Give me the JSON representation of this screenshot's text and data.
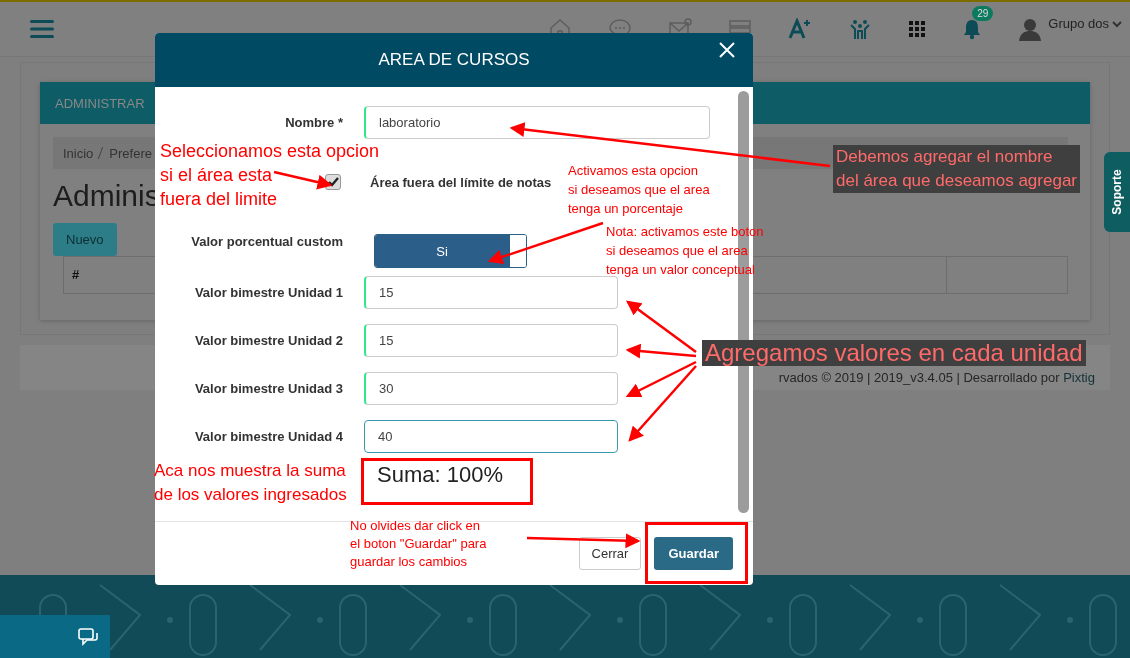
{
  "header": {
    "user_name": "Grupo dos",
    "notification_count": "29"
  },
  "background_page": {
    "panel_title": "ADMINISTRAR",
    "breadcrumb": [
      {
        "label": "Inicio"
      },
      {
        "label": "Prefere"
      }
    ],
    "heading": "Adminis",
    "new_button": "Nuevo",
    "table_columns": [
      "#"
    ],
    "footer_text": "rvados © 2019 | 2019_v3.4.05 | Desarrollado por",
    "footer_link": "Pixtig"
  },
  "support_tab": "Soporte",
  "modal": {
    "title": "AREA DE CURSOS",
    "name_field": {
      "label": "Nombre *",
      "value": "laboratorio",
      "focused": false
    },
    "checkbox": {
      "label": "Área fuera del límite de notas",
      "checked": true
    },
    "toggle": {
      "label": "Valor porcentual custom",
      "text": "Si",
      "on": true
    },
    "units": [
      {
        "label": "Valor bimestre Unidad 1",
        "value": "15",
        "focused": false
      },
      {
        "label": "Valor bimestre Unidad 2",
        "value": "15",
        "focused": false
      },
      {
        "label": "Valor bimestre Unidad 3",
        "value": "30",
        "focused": false
      },
      {
        "label": "Valor bimestre Unidad 4",
        "value": "40",
        "focused": true
      }
    ],
    "sum": "Suma: 100%",
    "buttons": [
      {
        "label": "Cerrar",
        "kind": "secondary"
      },
      {
        "label": "Guardar",
        "kind": "primary"
      }
    ]
  },
  "annotations": [
    {
      "lines": [
        "Seleccionamos esta opcion",
        "si el área esta",
        "fuera del limite"
      ]
    },
    {
      "lines": [
        "Debemos agregar el nombre",
        "del área que deseamos agregar"
      ]
    },
    {
      "lines": [
        "Activamos esta opcion",
        "si deseamos que el area",
        "tenga un porcentaje"
      ]
    },
    {
      "lines": [
        "Nota: activamos este boton",
        "si deseamos que el area",
        "tenga un valor conceptual"
      ]
    },
    {
      "lines": [
        "Agregamos valores en cada unidad"
      ]
    },
    {
      "lines": [
        "Aca nos muestra la suma",
        "de los valores ingresados"
      ]
    },
    {
      "lines": [
        "No olvides dar click en",
        "el boton \"Guardar\" para",
        "guardar los cambios"
      ]
    }
  ]
}
